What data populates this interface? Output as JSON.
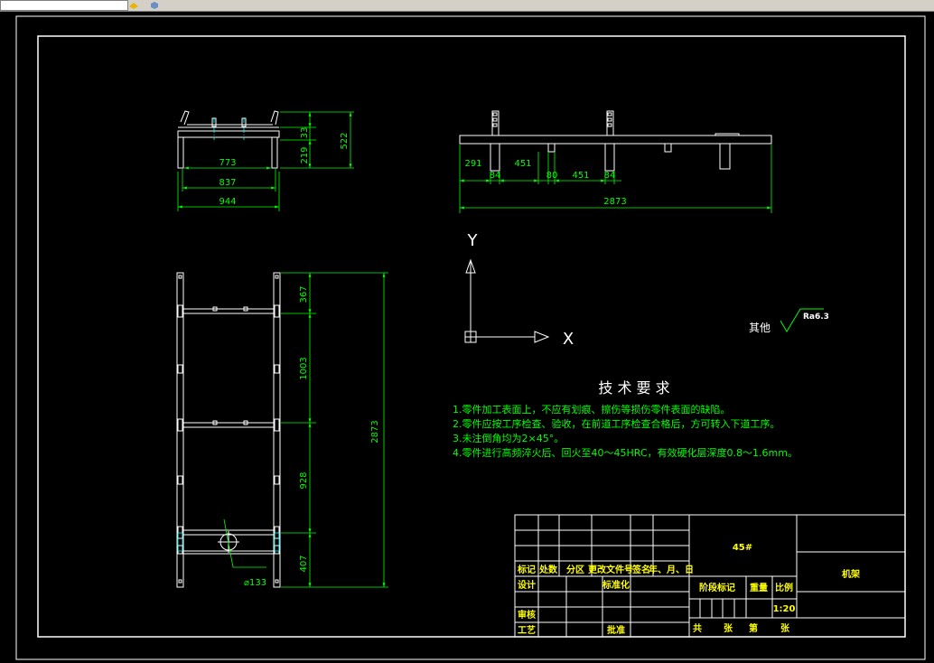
{
  "front_view": {
    "dims": {
      "d773": "773",
      "d837": "837",
      "d944": "944",
      "d33": "33",
      "d219": "219",
      "d522": "522"
    }
  },
  "side_view": {
    "dims": {
      "d291": "291",
      "d84a": "84",
      "d451a": "451",
      "d80": "80",
      "d451b": "451",
      "d84b": "84",
      "d2873": "2873"
    }
  },
  "plan_view": {
    "dims": {
      "d367": "367",
      "d1003": "1003",
      "d928": "928",
      "d407": "407",
      "d2873": "2873",
      "dia": "⌀133"
    }
  },
  "axes": {
    "y": "Y",
    "x": "X"
  },
  "roughness": {
    "label": "其他",
    "value": "Ra6.3"
  },
  "tech": {
    "title": "技 术 要 求",
    "items": [
      "1.零件加工表面上，不应有划痕、擦伤等损伤零件表面的缺陷。",
      "2.零件应按工序检查、验收，在前道工序检查合格后，方可转入下道工序。",
      "3.未注倒角均为2×45°。",
      "4.零件进行高频淬火后、回火至40～45HRC，有效硬化层深度0.8～1.6mm。"
    ]
  },
  "title_block": {
    "material": "45#",
    "name": "机架",
    "scale": "1:20",
    "headers": {
      "mark": "标记",
      "count": "处数",
      "zone": "分区",
      "doc": "更改文件号",
      "sign": "签名",
      "date": "年、月、日"
    },
    "design": "设计",
    "std": "标准化",
    "review": "审核",
    "process": "工艺",
    "approve": "批准",
    "stage": "阶段标记",
    "weight": "重量",
    "scale_label": "比例",
    "total": "共",
    "sheet1": "张",
    "page": "第",
    "sheet2": "张"
  },
  "colors": {
    "background": "#000000",
    "lines": "#ffffff",
    "dimensions": "#00ff00",
    "centerline": "#00ffff",
    "title_text": "#ffff00"
  }
}
